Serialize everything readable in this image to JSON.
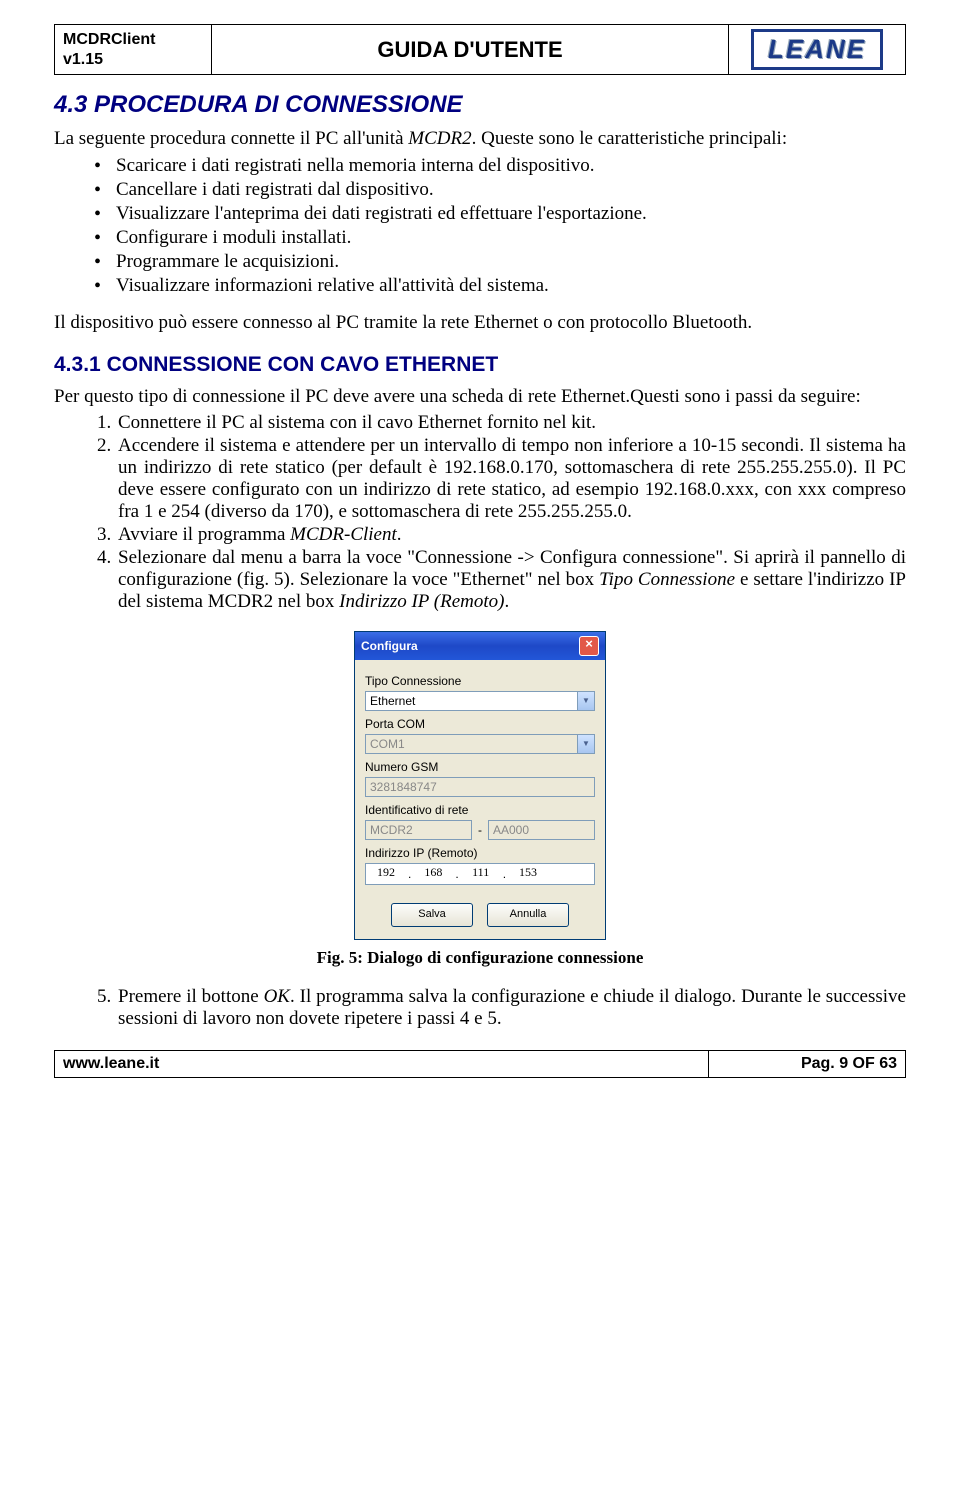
{
  "header": {
    "product_line1": "MCDRClient",
    "product_line2": "v1.15",
    "title": "GUIDA D'UTENTE",
    "logo_text": "LEANE"
  },
  "section": {
    "number": "4.3",
    "title": "PROCEDURA DI CONNESSIONE",
    "intro_a": "La seguente procedura connette il PC all'unità ",
    "intro_unit": "MCDR2",
    "intro_b": ".   Queste sono le caratteristiche principali:",
    "bullets": [
      "Scaricare i dati registrati nella memoria interna del dispositivo.",
      "Cancellare i dati registrati dal dispositivo.",
      "Visualizzare l'anteprima dei dati registrati ed effettuare l'esportazione.",
      "Configurare i moduli installati.",
      "Programmare le acquisizioni.",
      "Visualizzare informazioni relative all'attività del sistema."
    ],
    "outro": "Il dispositivo può essere connesso al PC tramite la rete Ethernet o con protocollo Bluetooth."
  },
  "subsection": {
    "number": "4.3.1",
    "title": "CONNESSIONE CON CAVO ETHERNET",
    "intro": "Per questo tipo di connessione il PC deve avere una scheda di rete Ethernet.Questi sono i passi da seguire:",
    "steps": {
      "s1": "Connettere il PC al sistema con il cavo Ethernet fornito nel kit.",
      "s2": "Accendere il sistema e attendere per un intervallo di tempo non inferiore a 10-15 secondi. Il sistema ha un indirizzo di rete statico (per default è 192.168.0.170, sottomaschera di rete 255.255.255.0). Il PC deve essere configurato con un indirizzo di rete statico, ad esempio 192.168.0.xxx, con xxx compreso fra 1 e 254 (diverso da 170), e sottomaschera di rete 255.255.255.0.",
      "s3a": "Avviare il programma ",
      "s3b": "MCDR-Client",
      "s3c": ".",
      "s4a": "Selezionare dal menu a barra la voce \"Connessione -> Configura connessione\". Si aprirà il pannello di configurazione (fig. 5). Selezionare la voce \"Ethernet\" nel box ",
      "s4b": "Tipo Connessione",
      "s4c": " e settare l'indirizzo IP del sistema MCDR2 nel box ",
      "s4d": "Indirizzo IP (Remoto)",
      "s4e": "."
    },
    "caption": "Fig. 5: Dialogo di configurazione connessione",
    "step5a": "Premere il bottone ",
    "step5b": "OK",
    "step5c": ". Il programma salva la configurazione e chiude il dialogo. Durante le successive sessioni di lavoro non dovete ripetere i passi 4 e 5."
  },
  "dialog": {
    "title": "Configura",
    "lbl_tipo": "Tipo Connessione",
    "val_tipo": "Ethernet",
    "lbl_com": "Porta COM",
    "val_com": "COM1",
    "lbl_gsm": "Numero GSM",
    "val_gsm": "3281848747",
    "lbl_ident": "Identificativo di rete",
    "val_ident1": "MCDR2",
    "val_ident2": "AA000",
    "lbl_ip": "Indirizzo IP (Remoto)",
    "ip1": "192",
    "ip2": "168",
    "ip3": "111",
    "ip4": "153",
    "btn_save": "Salva",
    "btn_cancel": "Annulla"
  },
  "footer": {
    "left": "www.leane.it",
    "right": "Pag. 9 OF 63"
  }
}
